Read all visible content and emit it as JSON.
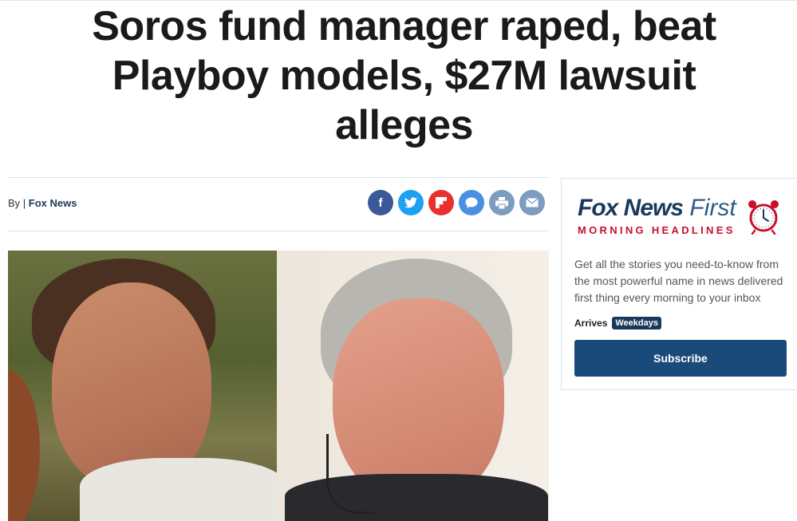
{
  "article": {
    "headline": "Soros fund manager raped, beat Playboy models, $27M lawsuit alleges",
    "byline_prefix": "By | ",
    "byline_author": "Fox News"
  },
  "share": {
    "facebook_glyph": "f",
    "icons": [
      "facebook-icon",
      "twitter-icon",
      "flipboard-icon",
      "comment-icon",
      "print-icon",
      "email-icon"
    ]
  },
  "newsletter": {
    "title_bold": "Fox News",
    "title_light": "First",
    "subtitle": "MORNING HEADLINES",
    "description": "Get all the stories you need-to-know from the most powerful name in news delivered first thing every morning to your inbox",
    "arrives_label": "Arrives",
    "arrives_value": "Weekdays",
    "subscribe_label": "Subscribe",
    "icon": "alarm-clock-icon"
  },
  "colors": {
    "brand_navy": "#183a5a",
    "brand_red": "#c8102e",
    "subscribe_blue": "#1a4a7a"
  }
}
